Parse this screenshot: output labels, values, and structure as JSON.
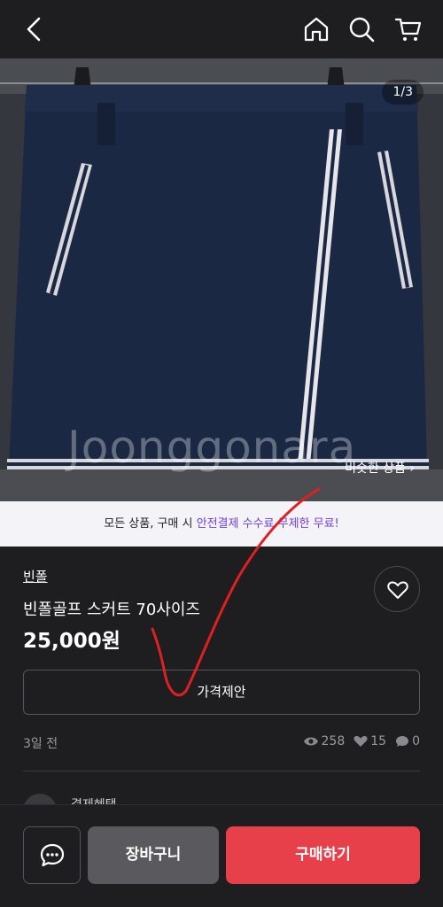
{
  "header": {
    "back_icon": "chevron-left-icon",
    "home_icon": "home-icon",
    "search_icon": "search-icon",
    "cart_icon": "shopping-cart-icon"
  },
  "gallery": {
    "page_indicator": "1/3",
    "watermark": "Joonggonara",
    "similar_link": "비슷한 상품 ›",
    "current_index": 1,
    "total": 3
  },
  "banner": {
    "prefix": "모든 상품, 구매 시 ",
    "highlight": "안전결제 수수료 무제한 무료!"
  },
  "product": {
    "store": "빈폴",
    "title": "빈폴골프 스커트 70사이즈",
    "price": "25,000원",
    "offer_button": "가격제안",
    "posted": "3일 전",
    "views": "258",
    "likes": "15",
    "chats": "0"
  },
  "seller": {
    "name": "결제혜택"
  },
  "actions": {
    "chat_icon": "chat-bubble-icon",
    "cart_label": "장바구니",
    "buy_label": "구매하기"
  },
  "colors": {
    "background": "#1e1e20",
    "accent_purple": "#6d3fe0",
    "buy_red": "#e8404a",
    "cart_gray": "#5a5a5e",
    "annotation_red": "#e02020"
  }
}
